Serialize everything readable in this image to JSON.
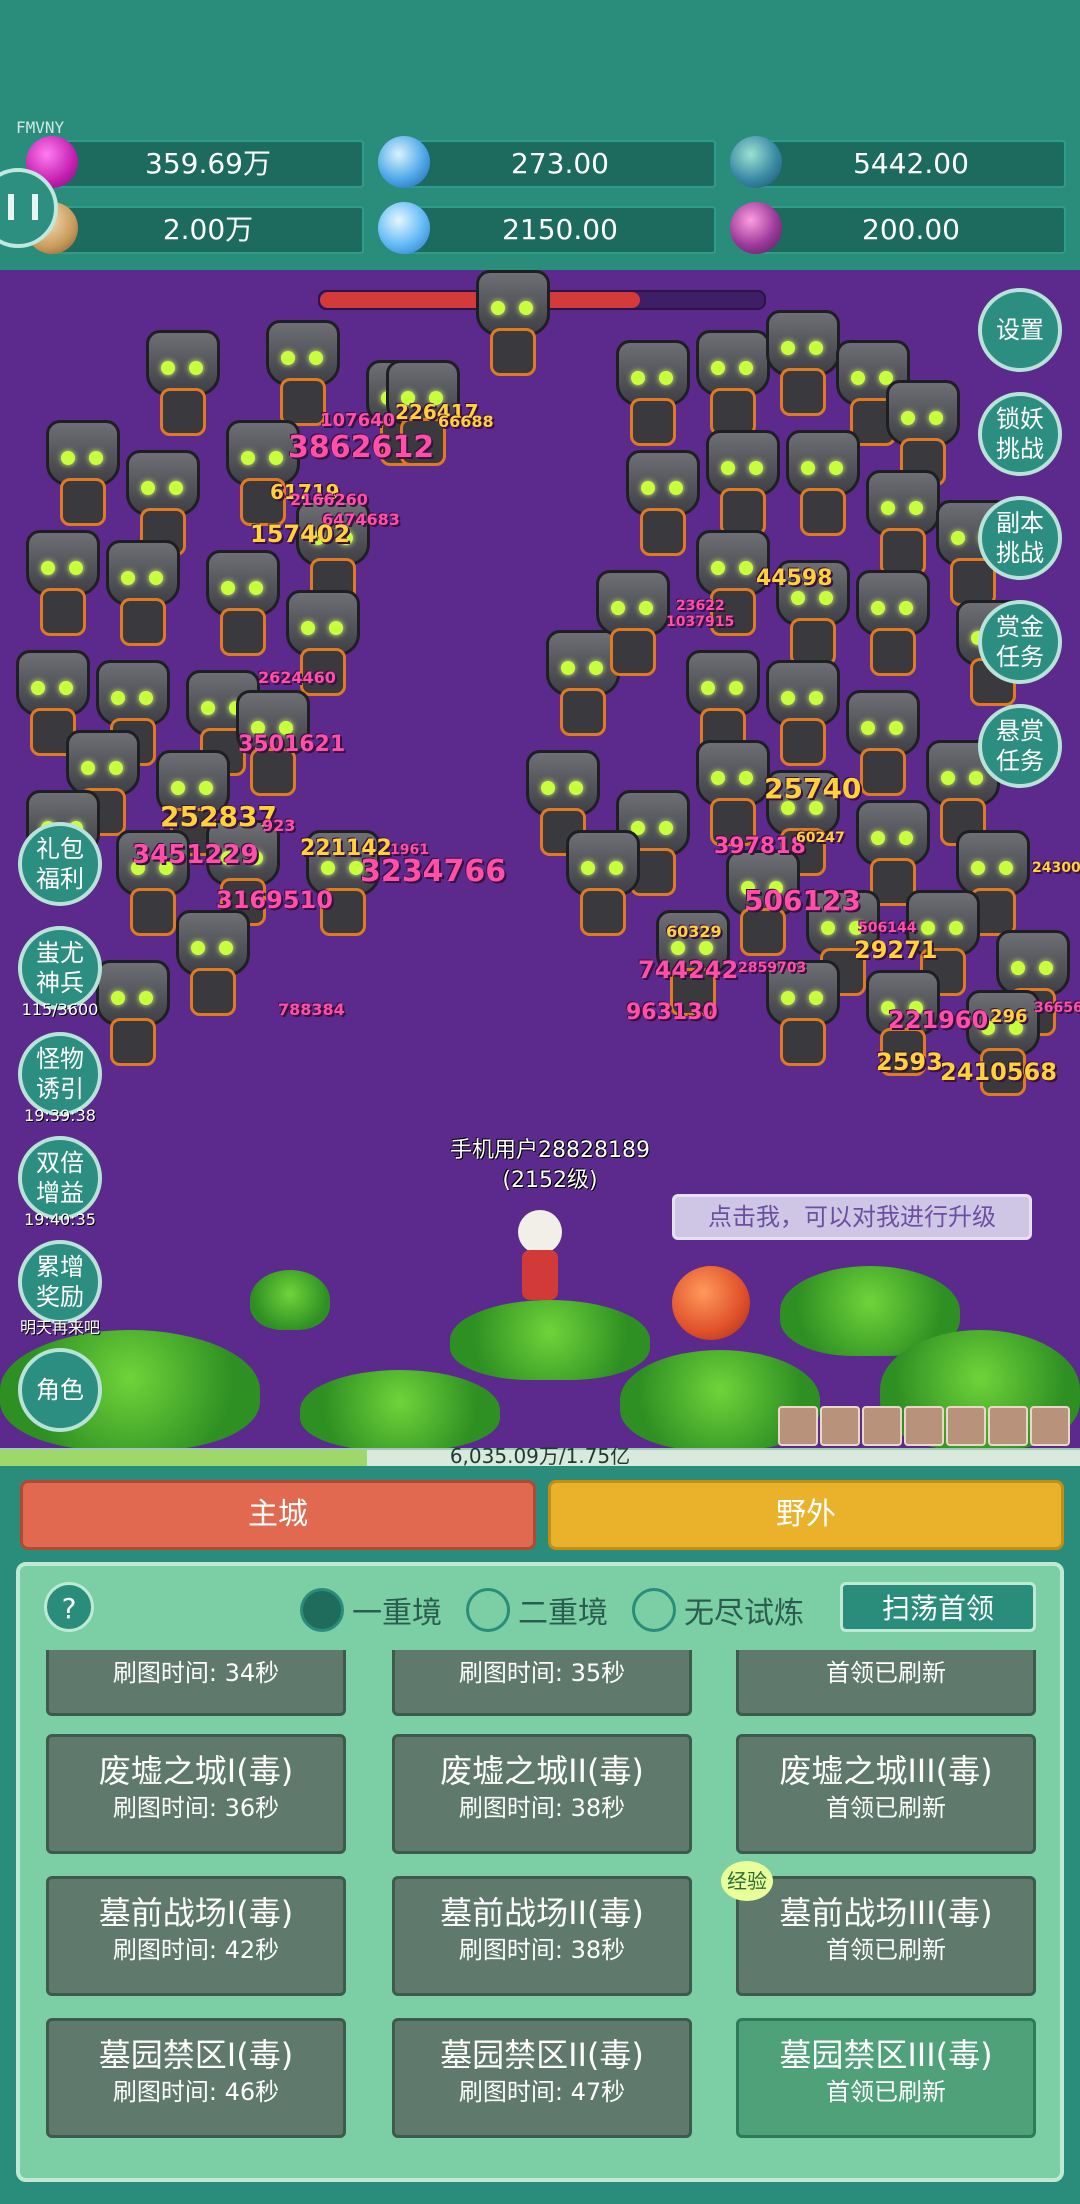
{
  "header": {
    "tag": "FMVNY",
    "resources": [
      {
        "icon": "gem-icon",
        "value": "359.69万"
      },
      {
        "icon": "orb-icon",
        "value": "273.00"
      },
      {
        "icon": "globe-icon",
        "value": "5442.00"
      },
      {
        "icon": "scroll-icon",
        "value": "2.00万"
      },
      {
        "icon": "crystal-icon",
        "value": "2150.00"
      },
      {
        "icon": "bag-icon",
        "value": "200.00"
      }
    ]
  },
  "battle": {
    "boss_hp_fraction": 0.72,
    "damage_numbers": [
      "107640",
      "226417",
      "66688",
      "3862612",
      "61719",
      "2166260",
      "6474683",
      "157402",
      "2624460",
      "3501621",
      "252837",
      "923",
      "3451229",
      "221142",
      "1961",
      "3234766",
      "3169510",
      "788384",
      "23622",
      "1037915",
      "44598",
      "25740",
      "397818",
      "60247",
      "506123",
      "60329",
      "744242",
      "963130",
      "506144",
      "29271",
      "221960",
      "296",
      "2593",
      "2410568",
      "2859703",
      "24300",
      "36656"
    ],
    "player_name": "手机用户28828189",
    "player_level": "(2152级)",
    "hint": "点击我，可以对我进行升级",
    "exp_text": "6,035.09万/1.75亿",
    "exp_fraction": 0.34
  },
  "right_menu": [
    {
      "label": "设置"
    },
    {
      "line1": "锁妖",
      "line2": "挑战"
    },
    {
      "line1": "副本",
      "line2": "挑战"
    },
    {
      "line1": "赏金",
      "line2": "任务"
    },
    {
      "line1": "悬赏",
      "line2": "任务"
    }
  ],
  "left_menu": [
    {
      "line1": "礼包",
      "line2": "福利",
      "sub": ""
    },
    {
      "line1": "蚩尤",
      "line2": "神兵",
      "sub": "115/3600"
    },
    {
      "line1": "怪物",
      "line2": "诱引",
      "sub": "19:39:38"
    },
    {
      "line1": "双倍",
      "line2": "增益",
      "sub": "19:40:35"
    },
    {
      "line1": "累增",
      "line2": "奖励",
      "sub": "明天再来吧"
    },
    {
      "label": "角色"
    }
  ],
  "tabs": {
    "main": "主城",
    "wild": "野外"
  },
  "panel": {
    "help": "?",
    "radios": [
      {
        "label": "一重境",
        "selected": true
      },
      {
        "label": "二重境",
        "selected": false
      },
      {
        "label": "无尽试炼",
        "selected": false
      }
    ],
    "sweep_label": "扫荡首领",
    "exp_badge": "经验",
    "top_row": [
      "刷图时间: 34秒",
      "刷图时间: 35秒",
      "首领已刷新"
    ],
    "stages": [
      {
        "name": "废墟之城I(毒)",
        "status": "刷图时间: 36秒"
      },
      {
        "name": "废墟之城II(毒)",
        "status": "刷图时间: 38秒"
      },
      {
        "name": "废墟之城III(毒)",
        "status": "首领已刷新"
      },
      {
        "name": "墓前战场I(毒)",
        "status": "刷图时间: 42秒"
      },
      {
        "name": "墓前战场II(毒)",
        "status": "刷图时间: 38秒"
      },
      {
        "name": "墓前战场III(毒)",
        "status": "首领已刷新"
      },
      {
        "name": "墓园禁区I(毒)",
        "status": "刷图时间: 46秒"
      },
      {
        "name": "墓园禁区II(毒)",
        "status": "刷图时间: 47秒"
      },
      {
        "name": "墓园禁区III(毒)",
        "status": "首领已刷新"
      }
    ]
  }
}
